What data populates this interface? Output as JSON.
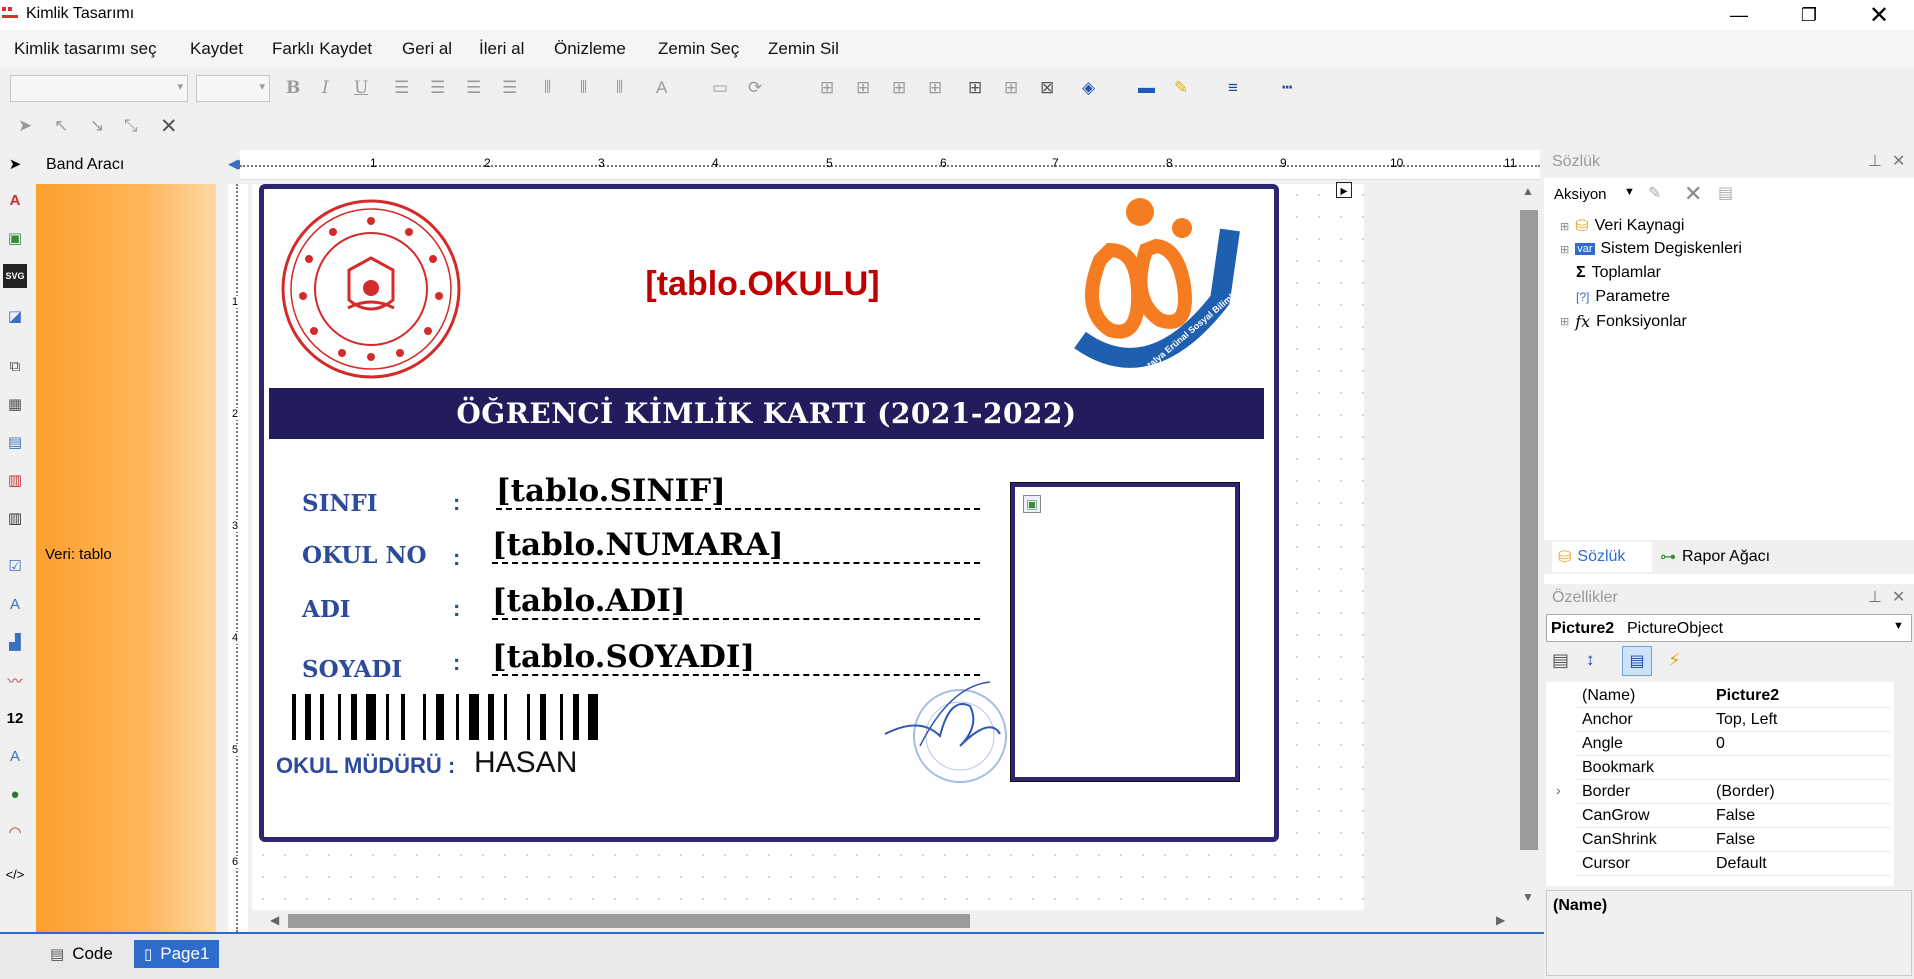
{
  "window": {
    "title": "Kimlik Tasarımı"
  },
  "menu": [
    "Kimlik tasarımı seç",
    "Kaydet",
    "Farklı Kaydet",
    "Geri al",
    "İleri al",
    "Önizleme",
    "Zemin Seç",
    "Zemin Sil"
  ],
  "band": {
    "header": "Band Aracı",
    "data_label": "Veri: tablo"
  },
  "ruler": {
    "marks": [
      "1",
      "2",
      "3",
      "4",
      "5",
      "6",
      "7",
      "8",
      "9",
      "10",
      "11"
    ],
    "vmarks": [
      "1",
      "2",
      "3",
      "4",
      "5",
      "6"
    ]
  },
  "card": {
    "school": "[tablo.OKULU]",
    "banner": "ÖĞRENCİ KİMLİK KARTI (2021-2022)",
    "fields": [
      {
        "label": "SINFI",
        "value": "[tablo.SINIF]"
      },
      {
        "label": "OKUL NO",
        "value": "[tablo.NUMARA]"
      },
      {
        "label": "ADI",
        "value": "[tablo.ADI]"
      },
      {
        "label": "SOYADI",
        "value": "[tablo.SOYADI]"
      }
    ],
    "colon": ":",
    "principal_label": "OKUL MÜDÜRÜ :",
    "principal_name": "HASAN",
    "logo_right_text": "Antalya Erünal Sosyal Bilimler Lisesi"
  },
  "bottom_tabs": {
    "code": "Code",
    "page": "Page1"
  },
  "dictionary": {
    "title": "Sözlük",
    "action": "Aksiyon",
    "items": [
      "Veri Kaynagi",
      "Sistem Degiskenleri",
      "Toplamlar",
      "Parametre",
      "Fonksiyonlar"
    ],
    "var_badge": "var",
    "tab_dict": "Sözlük",
    "tab_tree": "Rapor Ağacı"
  },
  "properties": {
    "title": "Özellikler",
    "object_name": "Picture2",
    "object_type": "PictureObject",
    "rows": [
      {
        "name": "(Name)",
        "value": "Picture2"
      },
      {
        "name": "Anchor",
        "value": "Top, Left"
      },
      {
        "name": "Angle",
        "value": "0"
      },
      {
        "name": "Bookmark",
        "value": ""
      },
      {
        "name": "Border",
        "value": "(Border)"
      },
      {
        "name": "CanGrow",
        "value": "False"
      },
      {
        "name": "CanShrink",
        "value": "False"
      },
      {
        "name": "Cursor",
        "value": "Default"
      }
    ],
    "description_title": "(Name)"
  },
  "colors": {
    "accent": "#2d2570",
    "school_red": "#c00000",
    "label_blue": "#2c4b9c",
    "band_orange": "#fc9f2c"
  }
}
